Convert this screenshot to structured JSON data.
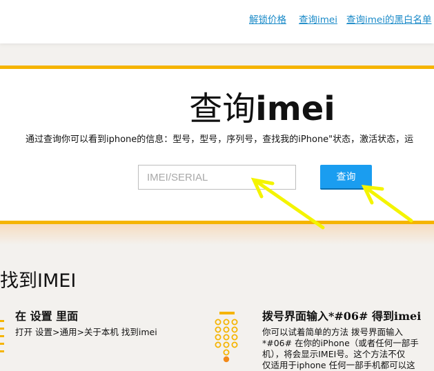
{
  "nav": {
    "unlock_price": "解锁价格",
    "check_imei": "查询imei",
    "blacklist": "查询imei的黑白名单"
  },
  "hero": {
    "title_cn": "查询",
    "title_latin": "imei",
    "subtitle": "通过查询你可以看到iphone的信息：型号，型号，序列号，查找我的iPhone\"状态，激活状态，运",
    "input_placeholder": "IMEI/SERIAL",
    "input_value": "",
    "query_button": "查询"
  },
  "find_section": {
    "title": "找到IMEI",
    "card_settings": {
      "title": "在 设置 里面",
      "text": "打开 设置>通用>关于本机 找到imei",
      "icon": "settings-icon"
    },
    "card_dialer": {
      "title": "拨号界面输入*#06# 得到imei",
      "lines": [
        "你可以试着简单的方法 拨号界面输入",
        "*#06# 在你的iPhone（或者任何一部手",
        "机），将会显示IMEI号。这个方法不仅",
        "仅适用于iphone 任何一部手机都可以这"
      ],
      "icon": "dialpad-icon"
    }
  },
  "colors": {
    "accent_yellow": "#f5b400",
    "link_blue": "#1a8ac8",
    "button_blue": "#1a9df0",
    "icon_orange": "#f5b400",
    "arrow_yellow": "#f4f400"
  }
}
